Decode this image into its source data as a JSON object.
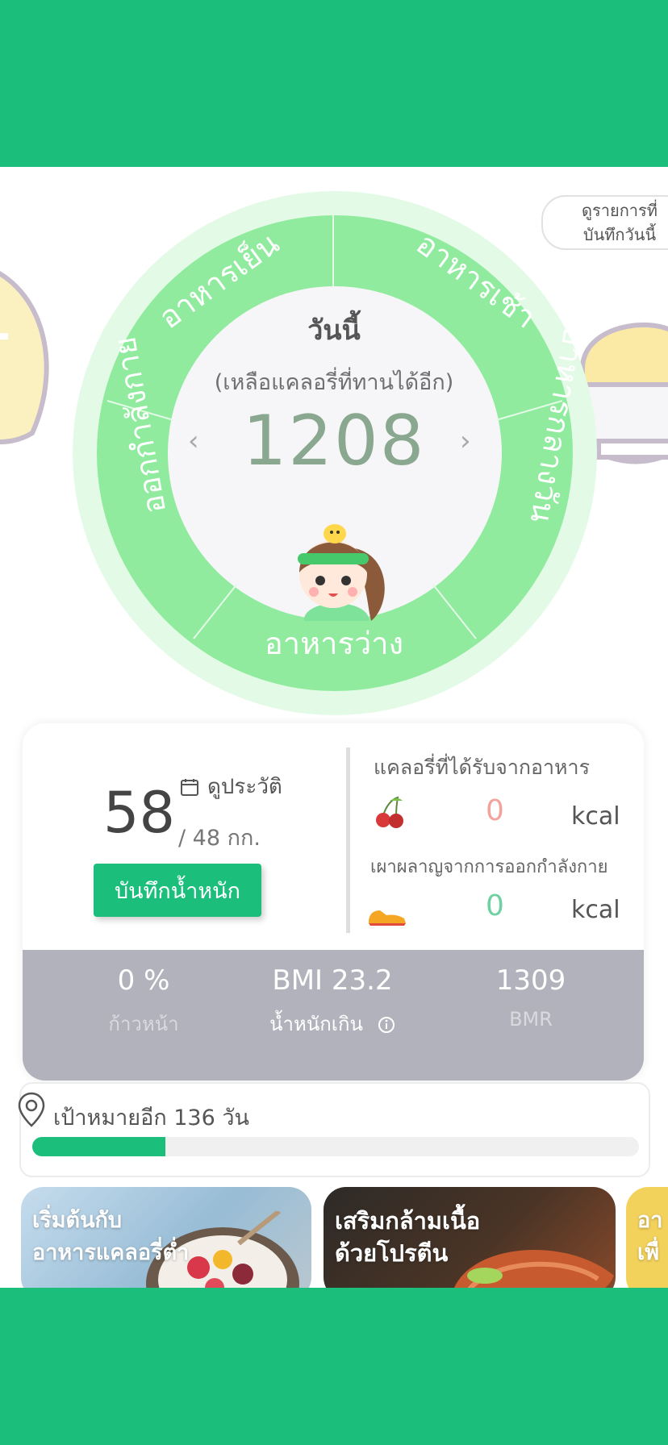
{
  "header": {},
  "wheel": {
    "segments": {
      "dinner": "อาหารเย็น",
      "breakfast": "อาหารเช้า",
      "lunch": "อาหารกลางวัน",
      "snack": "อาหารว่าง",
      "exercise": "ออกกำลังกาย"
    },
    "today_label": "วันนี้",
    "remaining_note": "(เหลือแคลอรี่ที่ทานได้อีก)",
    "remaining_calories": "1208",
    "prev_arrow": "‹",
    "next_arrow": "›"
  },
  "today_list_button": {
    "line1": "ดูรายการที่",
    "line2": "บันทึกวันนี้"
  },
  "weight": {
    "current": "58",
    "target": "/ 48 กก.",
    "history_label": "ดูประวัติ",
    "save_button": "บันทึกน้ำหนัก"
  },
  "calories": {
    "food_label": "แคลอรี่ที่ได้รับจากอาหาร",
    "food_value": "0",
    "food_unit": "kcal",
    "exercise_label": "เผาผลาญจากการออกกำลังกาย",
    "exercise_value": "0",
    "exercise_unit": "kcal"
  },
  "stats": {
    "progress_value": "0 %",
    "progress_label": "ก้าวหน้า",
    "bmi_value": "BMI 23.2",
    "bmi_label": "น้ำหนักเกิน",
    "bmr_value": "1309",
    "bmr_label": "BMR"
  },
  "goal": {
    "text": "เป้าหมายอีก 136 วัน",
    "progress_fraction": 0.22
  },
  "promos": [
    {
      "line1": "เริ่มต้นกับ",
      "line2": "อาหารแคลอรี่ต่ำ"
    },
    {
      "line1": "เสริมกล้ามเนื้อ",
      "line2": "ด้วยโปรตีน"
    },
    {
      "line1": "อา",
      "line2": "เพื่"
    }
  ],
  "colors": {
    "brand_green": "#1bbf7b",
    "wheel_ring": "#90eb9e",
    "stats_panel": "#b2b2bc"
  }
}
